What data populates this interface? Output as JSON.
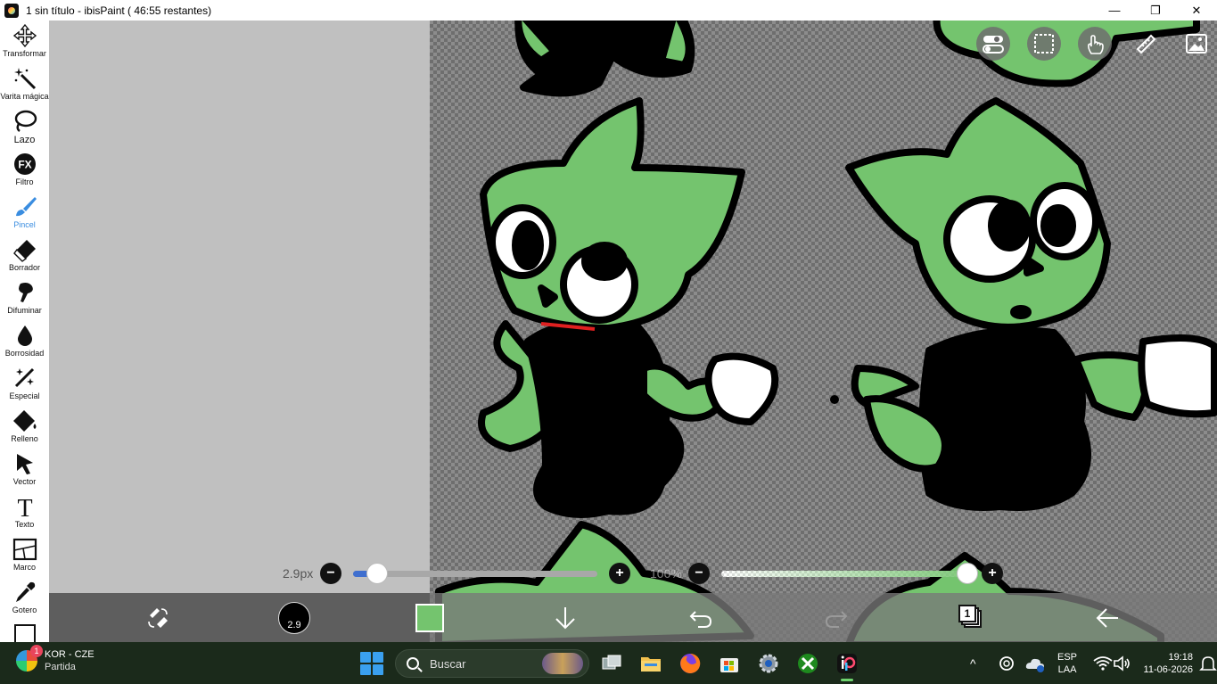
{
  "window": {
    "title": "1 sin título - ibisPaint ( 46:55 restantes)",
    "minimize_glyph": "—",
    "restore_glyph": "❐",
    "close_glyph": "✕"
  },
  "tools": [
    {
      "label": "Transformar",
      "icon": "move-icon"
    },
    {
      "label": "Varita mágica",
      "icon": "magic-wand-icon"
    },
    {
      "label": "Lazo",
      "icon": "lasso-icon"
    },
    {
      "label": "Filtro",
      "icon": "fx-icon"
    },
    {
      "label": "Pincel",
      "icon": "brush-icon",
      "active": true
    },
    {
      "label": "Borrador",
      "icon": "eraser-icon"
    },
    {
      "label": "Difuminar",
      "icon": "smudge-icon"
    },
    {
      "label": "Borrosidad",
      "icon": "blur-drop-icon"
    },
    {
      "label": "Especial",
      "icon": "special-brush-icon"
    },
    {
      "label": "Relleno",
      "icon": "fill-icon"
    },
    {
      "label": "Vector",
      "icon": "vector-arrow-icon"
    },
    {
      "label": "Texto",
      "icon": "text-icon"
    },
    {
      "label": "Marco",
      "icon": "frame-icon"
    },
    {
      "label": "Gotero",
      "icon": "eyedropper-icon"
    }
  ],
  "fx_glyph": "FX",
  "text_glyph": "T",
  "brush": {
    "size_label": "2.9px",
    "size_preview_label": "2.9",
    "size_fraction": 0.1,
    "opacity_label": "100%",
    "opacity_fraction": 1.0,
    "minus_glyph": "−",
    "plus_glyph": "+"
  },
  "colors": {
    "current_color": "#74c46e",
    "active_tool": "#3a8de0",
    "slider_fill": "#3f6fcf"
  },
  "bottom_bar": {
    "layer_count": "1"
  },
  "taskbar": {
    "weather_line1": "KOR - CZE",
    "weather_line2": "Partida",
    "notification_count": "1",
    "search_placeholder": "Buscar",
    "lang_line1": "ESP",
    "lang_line2": "LAA",
    "time": "19:18",
    "date": "11-06-2026",
    "chevron_glyph": "^"
  }
}
